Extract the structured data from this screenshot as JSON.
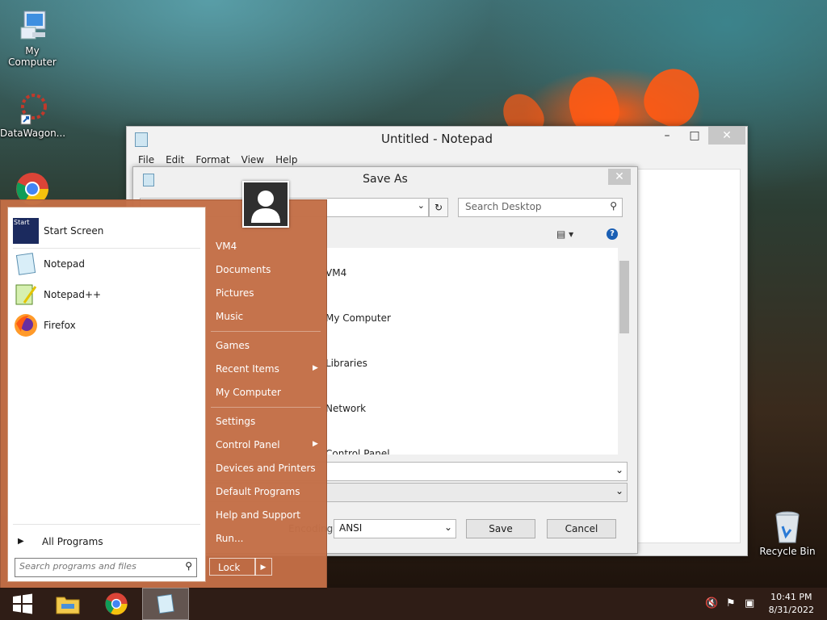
{
  "desktop": {
    "icons": [
      {
        "label": "My Computer"
      },
      {
        "label": "DataWagon..."
      },
      {
        "label": "Recycle Bin"
      }
    ]
  },
  "notepad": {
    "title": "Untitled - Notepad",
    "menu": [
      "File",
      "Edit",
      "Format",
      "View",
      "Help"
    ]
  },
  "saveas": {
    "title": "Save As",
    "search_placeholder": "Search Desktop",
    "items": [
      "VM4",
      "My Computer",
      "Libraries",
      "Network",
      "Control Panel"
    ],
    "encoding_label": "Encoding:",
    "encoding_value": "ANSI",
    "save_label": "Save",
    "cancel_label": "Cancel"
  },
  "startmenu": {
    "programs": [
      {
        "label": "Start Screen",
        "icon": "start-screen-icon"
      },
      {
        "label": "Notepad",
        "icon": "notepad-icon"
      },
      {
        "label": "Notepad++",
        "icon": "notepadpp-icon"
      },
      {
        "label": "Firefox",
        "icon": "firefox-icon"
      }
    ],
    "all_programs": "All Programs",
    "search_placeholder": "Search programs and files",
    "right_items": [
      "VM4",
      "Documents",
      "Pictures",
      "Music",
      "Games",
      "Recent Items",
      "My Computer",
      "Settings",
      "Control Panel",
      "Devices and Printers",
      "Default Programs",
      "Help and Support",
      "Run..."
    ],
    "lock_label": "Lock"
  },
  "taskbar": {
    "time": "10:41 PM",
    "date": "8/31/2022"
  },
  "colors": {
    "startmenu_bg": "#c36e46",
    "taskbar_bg": "#28160e",
    "accent_orange": "#ff5a14"
  }
}
